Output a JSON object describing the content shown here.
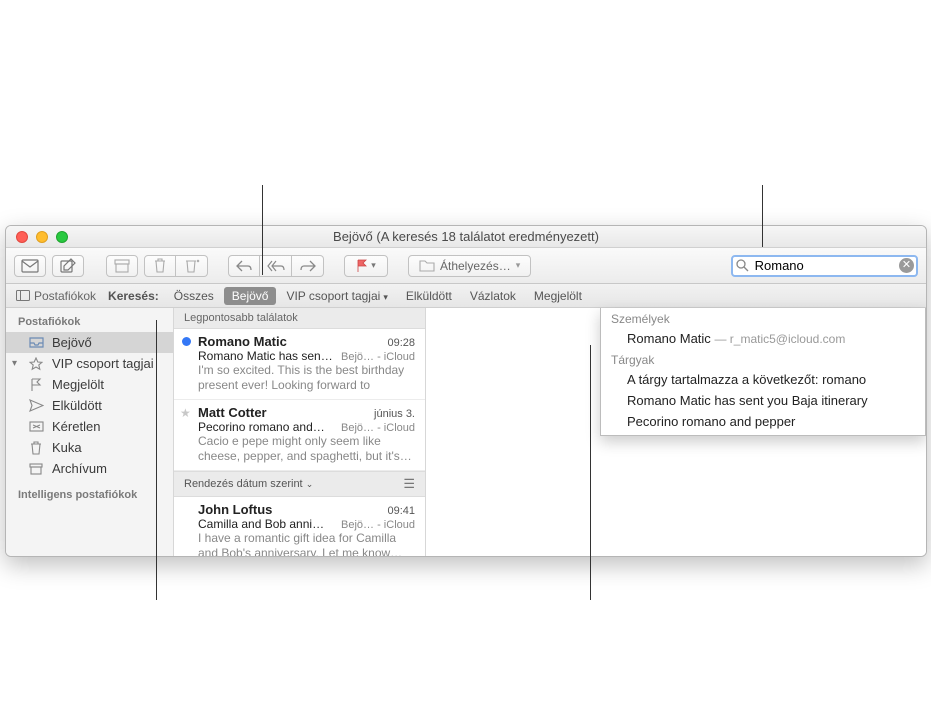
{
  "title": "Bejövő (A keresés 18 találatot eredményezett)",
  "toolbar": {
    "move_label": "Áthelyezés…"
  },
  "search": {
    "value": "Romano"
  },
  "filterbar": {
    "mailboxes": "Postafiókok",
    "label": "Keresés:",
    "tabs": [
      "Összes",
      "Bejövő",
      "VIP csoport tagjai",
      "Elküldött",
      "Vázlatok",
      "Megjelölt"
    ],
    "active_index": 1
  },
  "sidebar": {
    "header": "Postafiókok",
    "items": [
      {
        "icon": "inbox",
        "label": "Bejövő",
        "selected": true
      },
      {
        "icon": "vip",
        "label": "VIP csoport tagjai",
        "disclosure": true
      },
      {
        "icon": "flag",
        "label": "Megjelölt"
      },
      {
        "icon": "sent",
        "label": "Elküldött"
      },
      {
        "icon": "drafts",
        "label": "Kéretlen"
      },
      {
        "icon": "trash",
        "label": "Kuka"
      },
      {
        "icon": "archive",
        "label": "Archívum"
      }
    ],
    "smart_header": "Intelligens postafiókok"
  },
  "msglist": {
    "top_hits": "Legpontosabb találatok",
    "sort_label": "Rendezés dátum szerint",
    "messages_top": [
      {
        "unread": true,
        "sender": "Romano Matic",
        "time": "09:28",
        "subject": "Romano Matic has sent…",
        "meta": "Bejö… - iCloud",
        "preview": "I'm so excited. This is the best birthday present ever! Looking forward to finally…"
      },
      {
        "star": true,
        "sender": "Matt Cotter",
        "time": "június 3.",
        "subject": "Pecorino romano and…",
        "meta": "Bejö… - iCloud",
        "preview": "Cacio e pepe might only seem like cheese, pepper, and spaghetti, but it's…"
      }
    ],
    "messages_rest": [
      {
        "sender": "John Loftus",
        "time": "09:41",
        "subject": "Camilla and Bob anni…",
        "meta": "Bejö… - iCloud",
        "preview": "I have a romantic gift idea for Camilla and Bob's anniversary. Let me know…"
      }
    ]
  },
  "dropdown": {
    "people_header": "Személyek",
    "people": [
      {
        "name": "Romano Matic",
        "meta": "— r_matic5@icloud.com"
      }
    ],
    "subjects_header": "Tárgyak",
    "subjects": [
      "A tárgy tartalmazza a következőt: romano",
      "Romano Matic has sent you Baja itinerary",
      "Pecorino romano and pepper"
    ]
  }
}
